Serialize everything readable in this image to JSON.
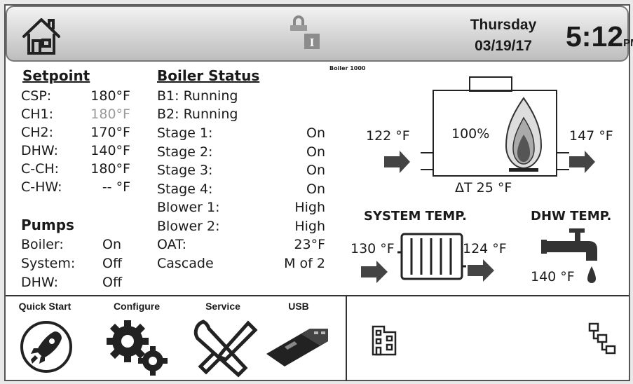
{
  "header": {
    "day": "Thursday",
    "date": "03/19/17",
    "time": "5:12",
    "ampm": "PM",
    "home_icon": "home-icon",
    "info_icon": "info-lock-icon"
  },
  "setpoint": {
    "title": "Setpoint",
    "rows": [
      {
        "label": "CSP:",
        "value": "180°F",
        "dimmed": false
      },
      {
        "label": "CH1:",
        "value": "180°F",
        "dimmed": true
      },
      {
        "label": "CH2:",
        "value": "170°F",
        "dimmed": false
      },
      {
        "label": "DHW:",
        "value": "140°F",
        "dimmed": false
      },
      {
        "label": "C-CH:",
        "value": "180°F",
        "dimmed": false
      },
      {
        "label": "C-HW:",
        "value": "-- °F",
        "dimmed": false
      }
    ]
  },
  "pumps": {
    "title": "Pumps",
    "rows": [
      {
        "label": "Boiler:",
        "value": "On"
      },
      {
        "label": "System:",
        "value": "Off"
      },
      {
        "label": "DHW:",
        "value": "Off"
      }
    ]
  },
  "boiler_status": {
    "title": "Boiler Status",
    "lines": [
      "B1: Running",
      "B2: Running"
    ],
    "rows": [
      {
        "label": "Stage 1:",
        "value": "On"
      },
      {
        "label": "Stage 2:",
        "value": "On"
      },
      {
        "label": "Stage 3:",
        "value": "On"
      },
      {
        "label": "Stage 4:",
        "value": "On"
      },
      {
        "label": "Blower 1:",
        "value": "High"
      },
      {
        "label": "Blower 2:",
        "value": "High"
      },
      {
        "label": "OAT:",
        "value": "23°F"
      },
      {
        "label": "Cascade",
        "value": "M of 2"
      }
    ]
  },
  "diagram": {
    "boiler_name": "Boiler 1000",
    "inlet_temp": "122 °F",
    "outlet_temp": "147 °F",
    "firing_rate": "100%",
    "delta_t": "ΔT 25 °F",
    "system_title": "SYSTEM TEMP.",
    "system_in": "130 °F",
    "system_out": "124 °F",
    "dhw_title": "DHW TEMP.",
    "dhw_temp": "140 °F"
  },
  "nav": {
    "items": [
      {
        "label": "Quick Start",
        "icon": "rocket-icon"
      },
      {
        "label": "Configure",
        "icon": "gears-icon"
      },
      {
        "label": "Service",
        "icon": "tools-icon"
      },
      {
        "label": "USB",
        "icon": "usb-drive-icon"
      }
    ],
    "right_icons": [
      "building-icon",
      "network-icon"
    ]
  }
}
